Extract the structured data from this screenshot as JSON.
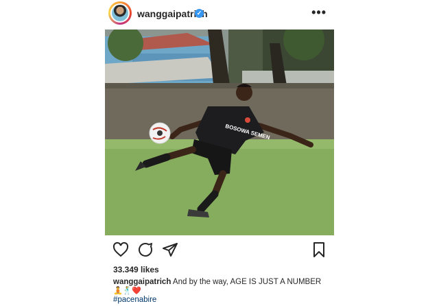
{
  "post": {
    "username": "wanggaipatrich",
    "verified_icon": "verified-badge-icon",
    "more_icon": "more-options-icon",
    "likes": "33.349 likes",
    "caption_user": "wanggaipatrich",
    "caption_text": "And by the way, AGE  IS JUST A NUMBER",
    "emoji_line": "🧘🕺❤️",
    "hashtag": "#pacenabire",
    "jersey_text": "BOSOWA SEMEN"
  },
  "colors": {
    "accent_blue": "#3897f0",
    "hashtag_blue": "#00376b",
    "text": "#262626"
  }
}
